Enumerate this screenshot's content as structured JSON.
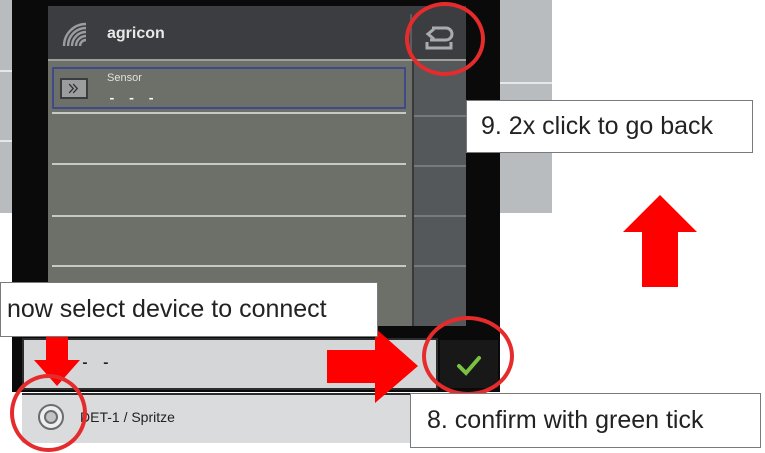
{
  "header": {
    "title": "agricon"
  },
  "sensor_row": {
    "label": "Sensor",
    "value": "- - -"
  },
  "dialog": {
    "row1_value": "- - -",
    "device_label": "DET-1 / Spritze"
  },
  "annotations": {
    "back": "9. 2x click to go back",
    "select": "now select device to connect",
    "confirm": "8. confirm with green tick"
  },
  "colors": {
    "annotation_red": "#e52b2b",
    "tick_green": "#7ac142",
    "selection_blue": "#3f4a8a"
  },
  "icons": {
    "logo": "signal-waves-icon",
    "back": "return-arrow-icon",
    "sensor": "double-chevron-right-icon",
    "confirm": "checkmark-icon",
    "device": "radio-button-icon"
  }
}
